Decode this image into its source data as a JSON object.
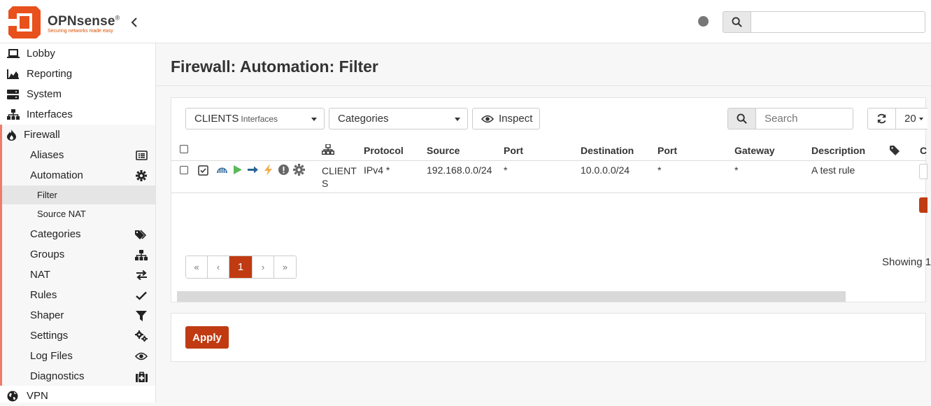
{
  "header": {
    "brand": "OPNsense",
    "brand_mark": "®",
    "tagline": "Securing networks made easy",
    "search_placeholder": ""
  },
  "sidebar": {
    "top_items": [
      {
        "label": "Lobby",
        "icon": "laptop-icon"
      },
      {
        "label": "Reporting",
        "icon": "area-chart-icon"
      },
      {
        "label": "System",
        "icon": "server-icon"
      },
      {
        "label": "Interfaces",
        "icon": "sitemap-icon"
      },
      {
        "label": "Firewall",
        "icon": "fire-icon"
      }
    ],
    "firewall_items": [
      {
        "label": "Aliases",
        "icon": "list-alt-icon"
      },
      {
        "label": "Automation",
        "icon": "gear-icon"
      },
      {
        "label": "Categories",
        "icon": "tags-icon"
      },
      {
        "label": "Groups",
        "icon": "sitemap-icon"
      },
      {
        "label": "NAT",
        "icon": "exchange-icon"
      },
      {
        "label": "Rules",
        "icon": "check-icon"
      },
      {
        "label": "Shaper",
        "icon": "filter-icon"
      },
      {
        "label": "Settings",
        "icon": "gears-icon"
      },
      {
        "label": "Log Files",
        "icon": "eye-icon"
      },
      {
        "label": "Diagnostics",
        "icon": "medkit-icon"
      }
    ],
    "automation_items": [
      {
        "label": "Filter",
        "active": true
      },
      {
        "label": "Source NAT",
        "active": false
      }
    ],
    "bottom_items": [
      {
        "label": "VPN",
        "icon": "globe-icon"
      }
    ]
  },
  "page": {
    "title": "Firewall: Automation: Filter"
  },
  "toolbar": {
    "interface_select": "CLIENTS",
    "interface_select_sub": "Interfaces",
    "categories_select": "Categories",
    "inspect_label": "Inspect",
    "search_placeholder": "Search",
    "rows_per_page": "20"
  },
  "table": {
    "columns": [
      "Protocol",
      "Source",
      "Port",
      "Destination",
      "Port",
      "Gateway",
      "Description",
      "C"
    ],
    "rows": [
      {
        "interface": "CLIENTS",
        "protocol": "IPv4 *",
        "source": "192.168.0.0/24",
        "source_port": "*",
        "destination": "10.0.0.0/24",
        "destination_port": "*",
        "gateway": "*",
        "description": "A test rule"
      }
    ]
  },
  "pagination": {
    "first": "«",
    "prev": "‹",
    "current": "1",
    "next": "›",
    "last": "»",
    "showing": "Showing 1"
  },
  "apply_label": "Apply",
  "colors": {
    "accent": "#c03b12",
    "logo": "#e8501c",
    "sidebar_highlight": "#ef7b6a"
  }
}
